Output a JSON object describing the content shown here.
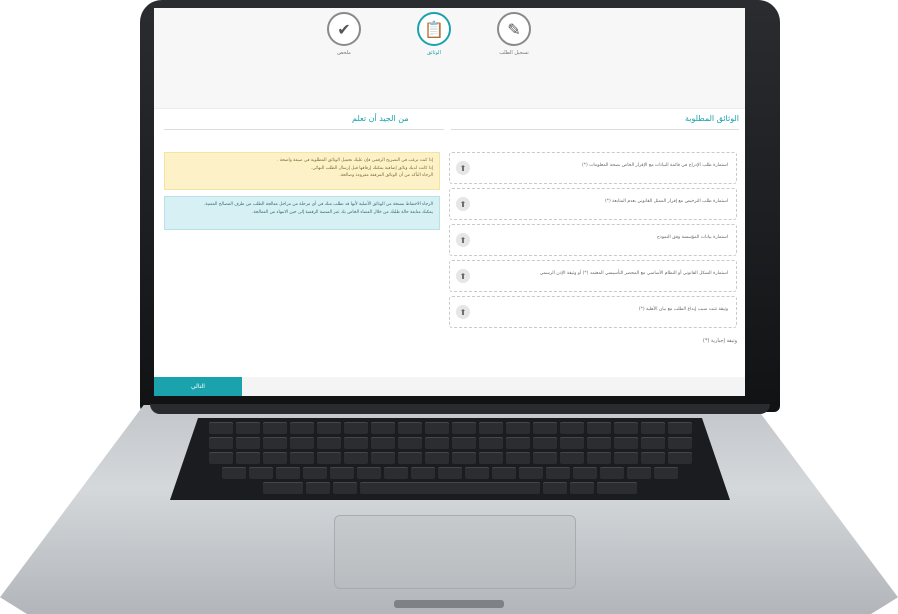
{
  "steps": [
    {
      "label": "ملخص",
      "icon": "✔"
    },
    {
      "label": "الوثائق",
      "icon": "📋"
    },
    {
      "label": "تسجيل الطلب",
      "icon": "✎"
    }
  ],
  "documents": {
    "title": "الوثائق المطلوبة",
    "items": [
      "استمارة طلب الإدراج في قائمة البيانات مع الإقرار الخاص بصحة المعلومات (*)",
      "استمارة طلب الترخيص مع إقرار الممثل القانوني بعدم المتابعة (*)",
      "استمارة بيانات المؤسسة وفق النموذج",
      "استمارة الشكل القانوني أو النظام الأساسي مع المحضر التأسيسي المعتمد (*) أو وثيقة الإذن الرسمي",
      "وثيقة تثبت سبب إيداع الطلب مع بيان الأهلية (*)"
    ],
    "footer_note": "وثيقة إجبارية (*)"
  },
  "notices": {
    "title": "من الجيد أن تعلم",
    "yellow_lines": [
      "إذا كنت ترغب في التصريح الرقمي فإن عليك تحميل الوثائق المطلوبة في صيغة واضحة .",
      "إذا كانت لديك وثائق إضافية يمكنك إرفاقها قبل إرسال الطلب النهائي.",
      "الرجاء التأكد من أن الوثائق المرفقة مقروءة وصالحة."
    ],
    "blue_lines": [
      "الرجاء الاحتفاظ بنسخة من الوثائق الأصلية لأنها قد تطلب منك في أي مرحلة من مراحل معالجة الطلب من طرف المصالح المعنية.",
      "يمكنك متابعة حالة طلبك من خلال الفضاء الخاص بك عبر المنصة الرقمية إلى حين الانتهاء من المعالجة."
    ]
  },
  "next_label": "التالي",
  "colors": {
    "accent": "#1aa3ac",
    "yellow_bg": "#fdf1c8",
    "blue_bg": "#d6f0f3"
  }
}
